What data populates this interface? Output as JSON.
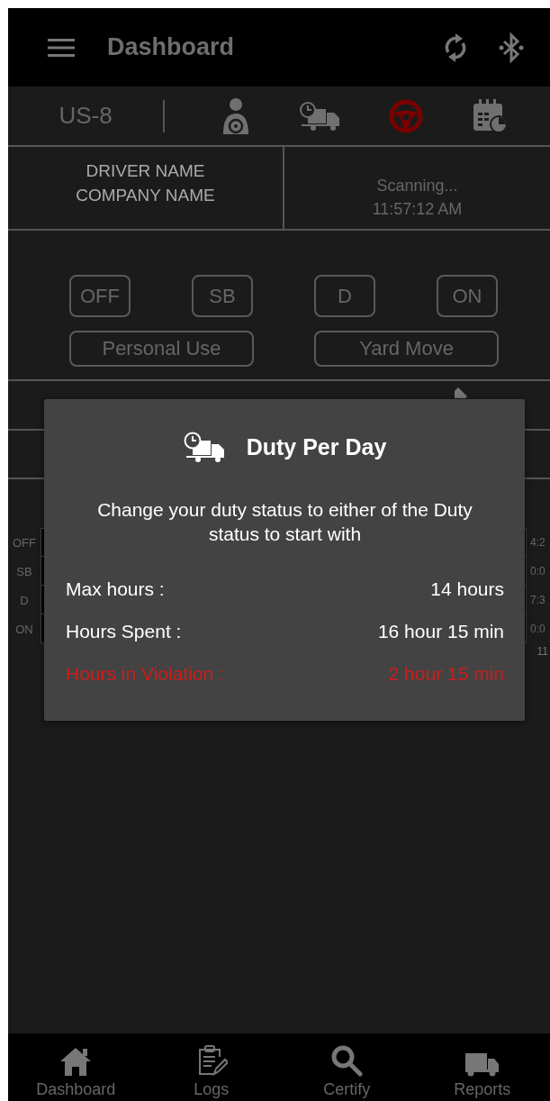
{
  "header": {
    "title": "Dashboard"
  },
  "toolbar": {
    "ruleset": "US-8",
    "icons": [
      {
        "kind": "driver",
        "selected": false
      },
      {
        "kind": "truck-clock",
        "selected": false
      },
      {
        "kind": "wheel",
        "selected": true
      },
      {
        "kind": "calendar",
        "selected": false
      }
    ]
  },
  "driver": {
    "name": "DRIVER NAME",
    "company": "COMPANY NAME"
  },
  "connection": {
    "status": "Scanning...",
    "time": "11:57:12 AM"
  },
  "duty_buttons": [
    "OFF",
    "SB",
    "D",
    "ON"
  ],
  "special_buttons": [
    "Personal Use",
    "Yard Move"
  ],
  "log_chart": {
    "rows": [
      {
        "status": "OFF",
        "total": "4:2"
      },
      {
        "status": "SB",
        "total": "0:0"
      },
      {
        "status": "D",
        "total": "7:3"
      },
      {
        "status": "ON",
        "total": "0:0"
      }
    ],
    "footer_total": "11"
  },
  "dialog": {
    "title": "Duty Per Day",
    "message": "Change your duty status to either of the Duty status to start with",
    "rows": [
      {
        "label": "Max hours :",
        "value": "14 hours",
        "violation": false
      },
      {
        "label": "Hours Spent :",
        "value": "16 hour 15 min",
        "violation": false
      },
      {
        "label": "Hours in Violation :",
        "value": "2 hour 15 min",
        "violation": true
      }
    ]
  },
  "nav": [
    {
      "label": "Dashboard",
      "kind": "home"
    },
    {
      "label": "Logs",
      "kind": "clipboard"
    },
    {
      "label": "Certify",
      "kind": "search"
    },
    {
      "label": "Reports",
      "kind": "truck"
    }
  ]
}
